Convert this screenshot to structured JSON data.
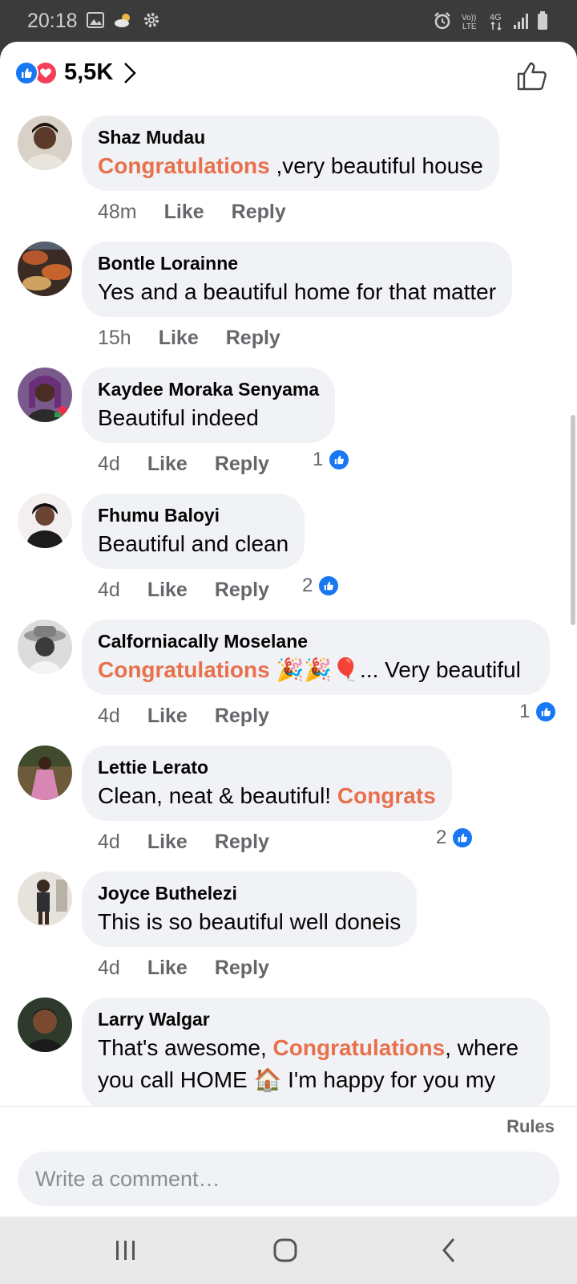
{
  "status_bar": {
    "time": "20:18",
    "network": "4G"
  },
  "header": {
    "reaction_count": "5,5K",
    "colors": {
      "like": "#1877f2",
      "love": "#f33e58"
    }
  },
  "comments": [
    {
      "author": "Shaz Mudau",
      "parts": [
        {
          "t": "Congratulations",
          "hl": true
        },
        {
          "t": " ,very beautiful house"
        }
      ],
      "time": "48m",
      "like": "Like",
      "reply": "Reply",
      "likes": ""
    },
    {
      "author": "Bontle Lorainne",
      "parts": [
        {
          "t": "Yes and a beautiful home for that matter"
        }
      ],
      "time": "15h",
      "like": "Like",
      "reply": "Reply",
      "likes": ""
    },
    {
      "author": "Kaydee Moraka Senyama",
      "parts": [
        {
          "t": "Beautiful indeed"
        }
      ],
      "time": "4d",
      "like": "Like",
      "reply": "Reply",
      "likes": "1"
    },
    {
      "author": "Fhumu Baloyi",
      "parts": [
        {
          "t": "Beautiful and clean"
        }
      ],
      "time": "4d",
      "like": "Like",
      "reply": "Reply",
      "likes": "2"
    },
    {
      "author": "Calforniacally Moselane",
      "parts": [
        {
          "t": "Congratulations",
          "hl": true
        },
        {
          "t": " 🎉🎉🎈... Very beautiful"
        }
      ],
      "time": "4d",
      "like": "Like",
      "reply": "Reply",
      "likes": "1"
    },
    {
      "author": "Lettie Lerato",
      "parts": [
        {
          "t": "Clean, neat & beautiful! "
        },
        {
          "t": "Congrats",
          "hl": true
        }
      ],
      "time": "4d",
      "like": "Like",
      "reply": "Reply",
      "likes": "2"
    },
    {
      "author": "Joyce Buthelezi",
      "parts": [
        {
          "t": "This is so beautiful well doneis"
        }
      ],
      "time": "4d",
      "like": "Like",
      "reply": "Reply",
      "likes": ""
    },
    {
      "author": "Larry Walgar",
      "parts": [
        {
          "t": "That's awesome, "
        },
        {
          "t": "Congratulations",
          "hl": true
        },
        {
          "t": ", where"
        }
      ],
      "line2": "you call HOME 🏠 I'm happy for you my",
      "time": "",
      "like": "",
      "reply": "",
      "likes": ""
    }
  ],
  "footer": {
    "rules": "Rules",
    "comment_placeholder": "Write a comment…"
  },
  "highlight_color": "#e9704d"
}
